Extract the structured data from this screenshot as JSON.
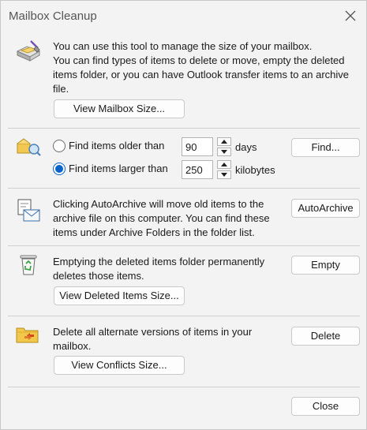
{
  "window": {
    "title": "Mailbox Cleanup"
  },
  "section1": {
    "line1": "You can use this tool to manage the size of your mailbox.",
    "line2": "You can find types of items to delete or move, empty the deleted items folder, or you can have Outlook transfer items to an archive file.",
    "view_size_button": "View Mailbox Size..."
  },
  "section2": {
    "older_label": "Find items older than",
    "older_value": "90",
    "older_unit": "days",
    "larger_label": "Find items larger than",
    "larger_value": "250",
    "larger_unit": "kilobytes",
    "selected": "larger",
    "find_button": "Find..."
  },
  "section3": {
    "text": "Clicking AutoArchive will move old items to the archive file on this computer. You can find these items under Archive Folders in the folder list.",
    "autoarchive_button": "AutoArchive"
  },
  "section4": {
    "text": "Emptying the deleted items folder permanently deletes those items.",
    "empty_button": "Empty",
    "view_deleted_button": "View Deleted Items Size..."
  },
  "section5": {
    "text": "Delete all alternate versions of items in your mailbox.",
    "delete_button": "Delete",
    "view_conflicts_button": "View Conflicts Size..."
  },
  "footer": {
    "close_button": "Close"
  }
}
